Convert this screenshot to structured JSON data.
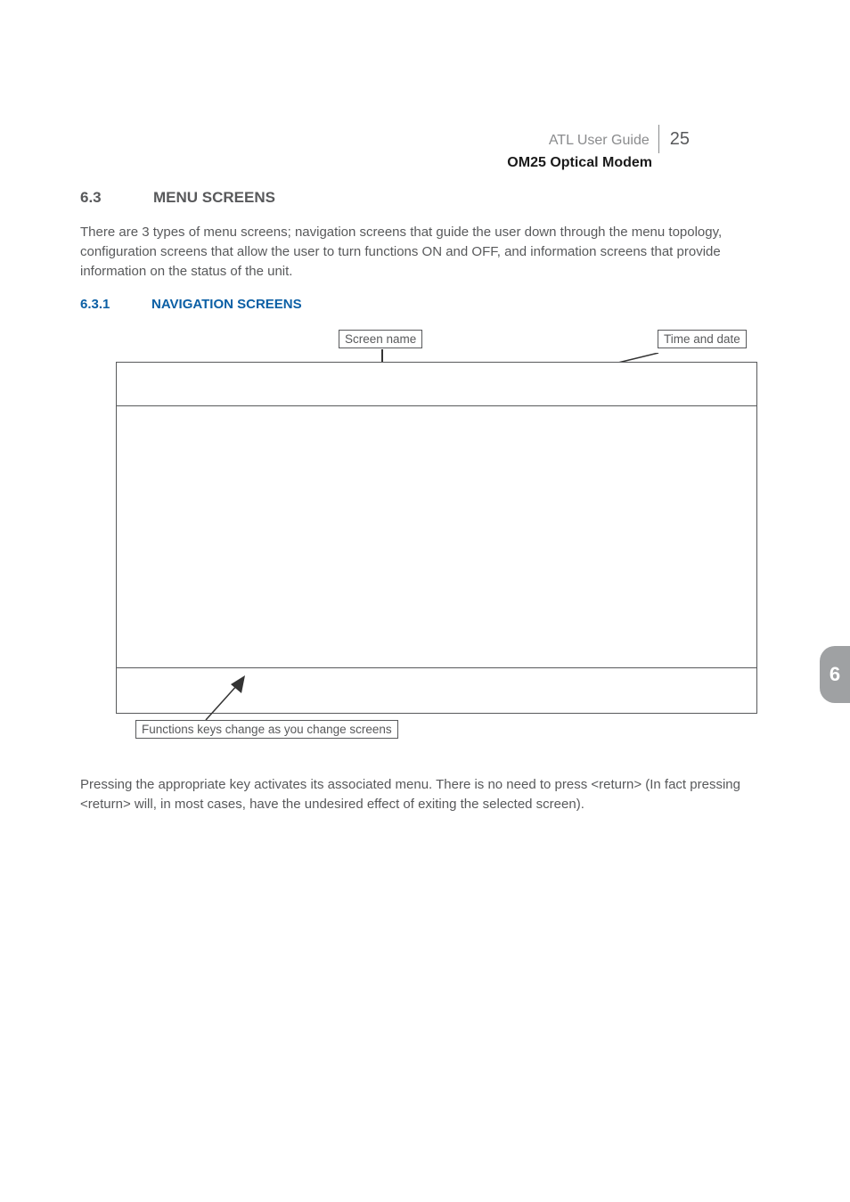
{
  "header": {
    "guide": "ATL User Guide",
    "page_number": "25",
    "product": "OM25 Optical Modem"
  },
  "section": {
    "number": "6.3",
    "title": "MENU SCREENS",
    "intro": "There are 3 types of menu screens; navigation screens that guide the user down through the menu topology, configuration screens that allow the user to turn functions ON and OFF, and information screens that provide information on the status of the unit."
  },
  "subsection": {
    "number": "6.3.1",
    "title": "NAVIGATION SCREENS"
  },
  "figure": {
    "callout_screen_name": "Screen name",
    "callout_time_date": "Time and date",
    "callout_func_keys": "Functions keys change as you change screens"
  },
  "closing_paragraph": "Pressing the appropriate key activates its associated menu. There is no need to press <return> (In fact pressing <return> will, in most cases, have the undesired effect of exiting the selected screen).",
  "chapter_tab": "6"
}
